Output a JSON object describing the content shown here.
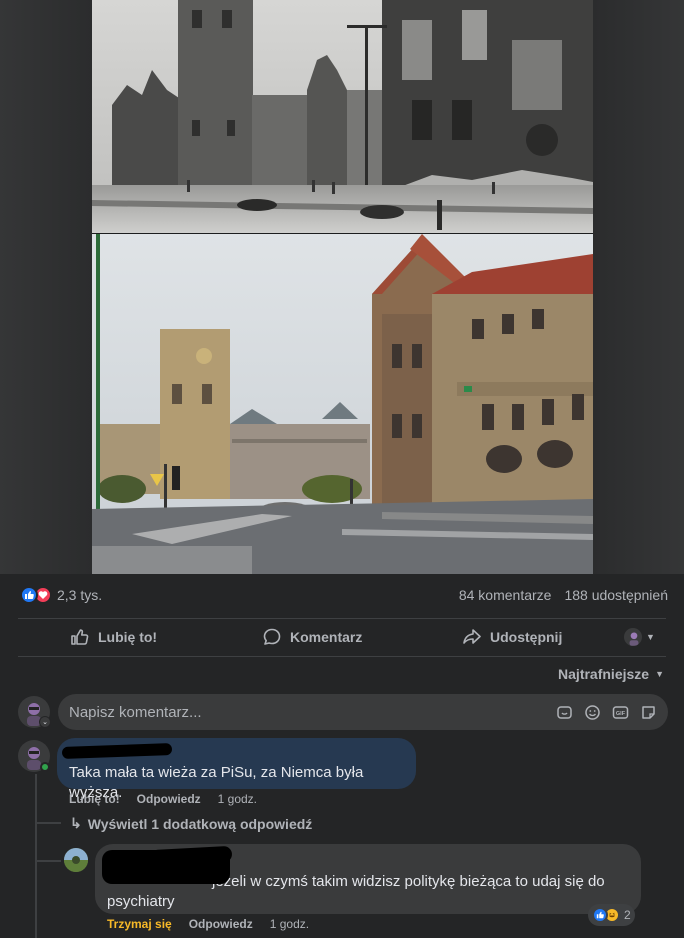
{
  "post": {
    "reaction_count": "2,3 tys.",
    "comments_count": "84 komentarze",
    "shares_count": "188 udostępnień"
  },
  "actions": {
    "like": "Lubię to!",
    "comment": "Komentarz",
    "share": "Udostępnij"
  },
  "sort": {
    "label": "Najtrafniejsze"
  },
  "composer": {
    "placeholder": "Napisz komentarz..."
  },
  "comments": [
    {
      "text": "Taka mała ta wieża za PiSu, za Niemca była wyższa.",
      "like_label": "Lubię to!",
      "reply_label": "Odpowiedz",
      "time": "1 godz."
    }
  ],
  "more_replies": "Wyświetl 1 dodatkową odpowiedź",
  "reply": {
    "text_line1": "jeżeli w czymś takim widzisz politykę bieżąca to udaj się do",
    "text_line2": "psychiatry",
    "hold_label": "Trzymaj się",
    "reply_label": "Odpowiedz",
    "time": "1 godz.",
    "reaction_count": "2"
  },
  "colors": {
    "background": "#242526",
    "bubble_own": "#263951",
    "bubble": "#3a3b3c",
    "like_blue": "#2078f4",
    "love_red": "#f33e58",
    "hold_yellow": "#f7b928"
  },
  "icons": [
    "like-icon",
    "love-icon",
    "haha-icon",
    "thumb-up-icon",
    "comment-icon",
    "share-icon",
    "chevron-down-icon",
    "sticker-icon",
    "emoji-icon",
    "gif-icon",
    "camera-icon",
    "reply-arrow-icon"
  ]
}
